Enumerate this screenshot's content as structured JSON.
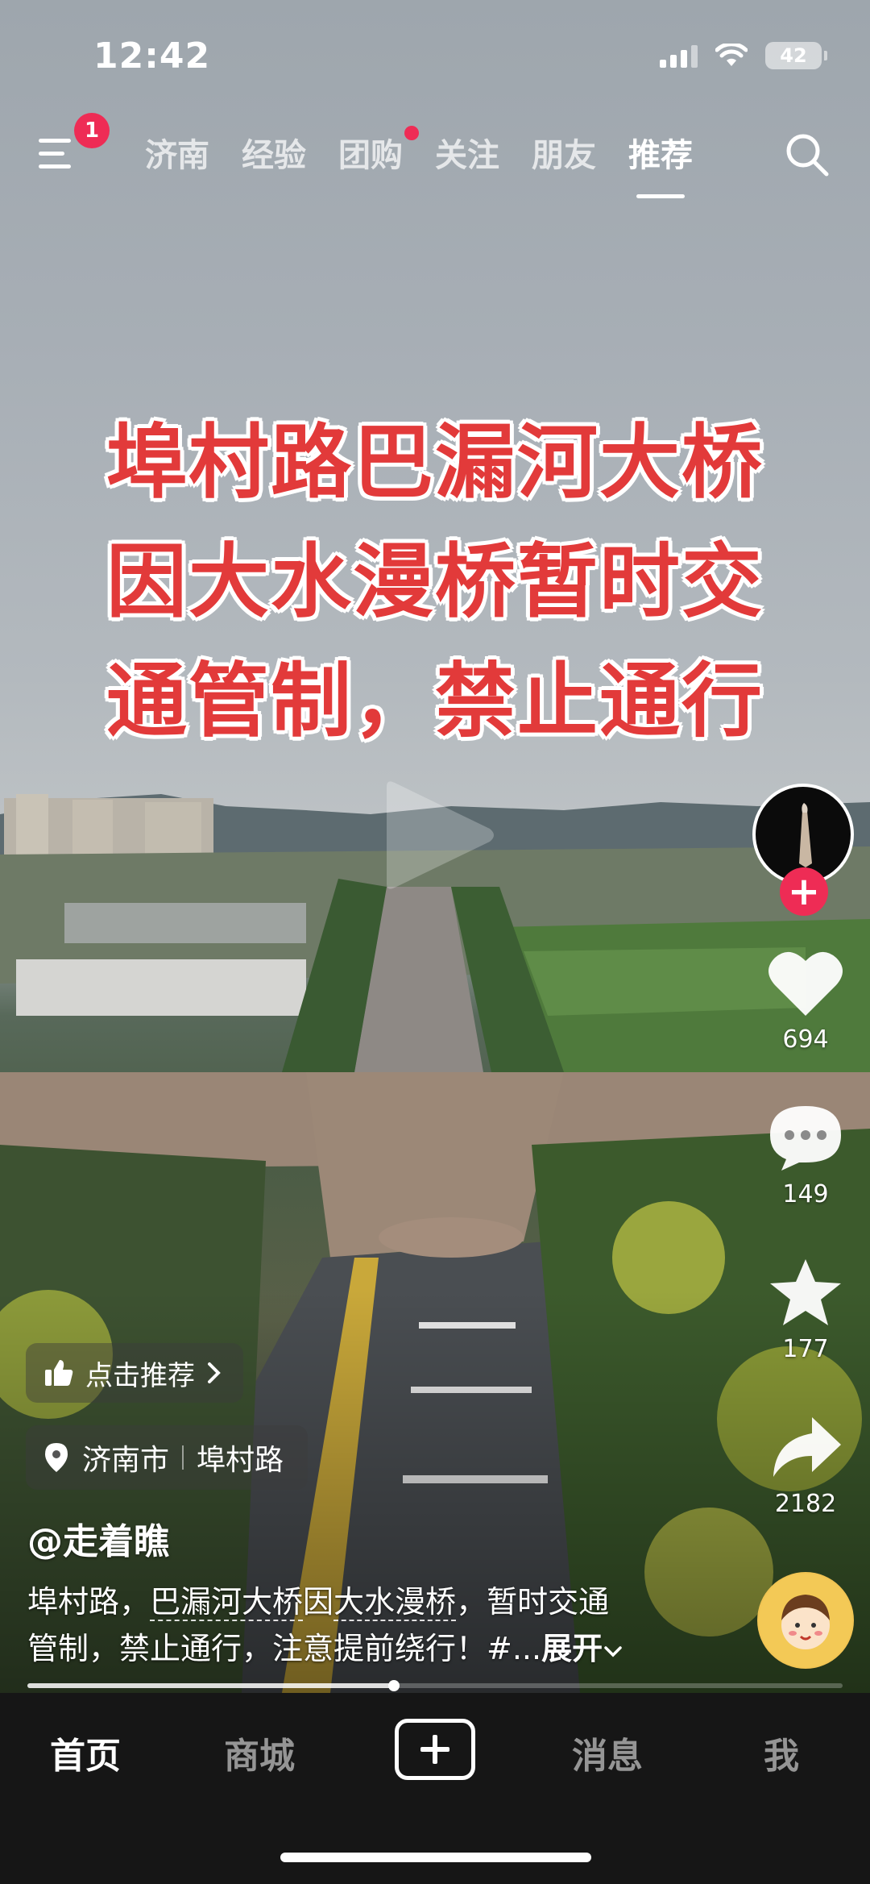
{
  "status_bar": {
    "time": "12:42",
    "battery": "42"
  },
  "top_nav": {
    "menu_badge": "1",
    "tabs": [
      "济南",
      "经验",
      "团购",
      "关注",
      "朋友",
      "推荐"
    ],
    "active_tab": "推荐",
    "dot_tab": "团购"
  },
  "video": {
    "overlay_text": [
      "埠村路巴漏河大桥",
      "因大水漫桥暂时交",
      "通管制，禁止通行"
    ]
  },
  "actions": {
    "likes": "694",
    "comments": "149",
    "favorites": "177",
    "shares": "2182"
  },
  "info": {
    "recommend_label": "点击推荐",
    "location_city": "济南市",
    "location_place": "埠村路",
    "author": "@走着瞧",
    "desc_line1_a": "埠村路，",
    "desc_line1_link1": "巴漏河大桥",
    "desc_line1_b": "因",
    "desc_line1_link2": "大水漫桥",
    "desc_line1_c": "，暂时交通",
    "desc_line2": "管制，禁止通行，注意提前绕行！#...",
    "expand_label": "展开"
  },
  "progress": 0.45,
  "bottom_nav": {
    "items": [
      "首页",
      "商城",
      "消息",
      "我"
    ],
    "active": "首页"
  },
  "colors": {
    "accent": "#ee2c55",
    "overlay_red": "#e23a3a"
  }
}
